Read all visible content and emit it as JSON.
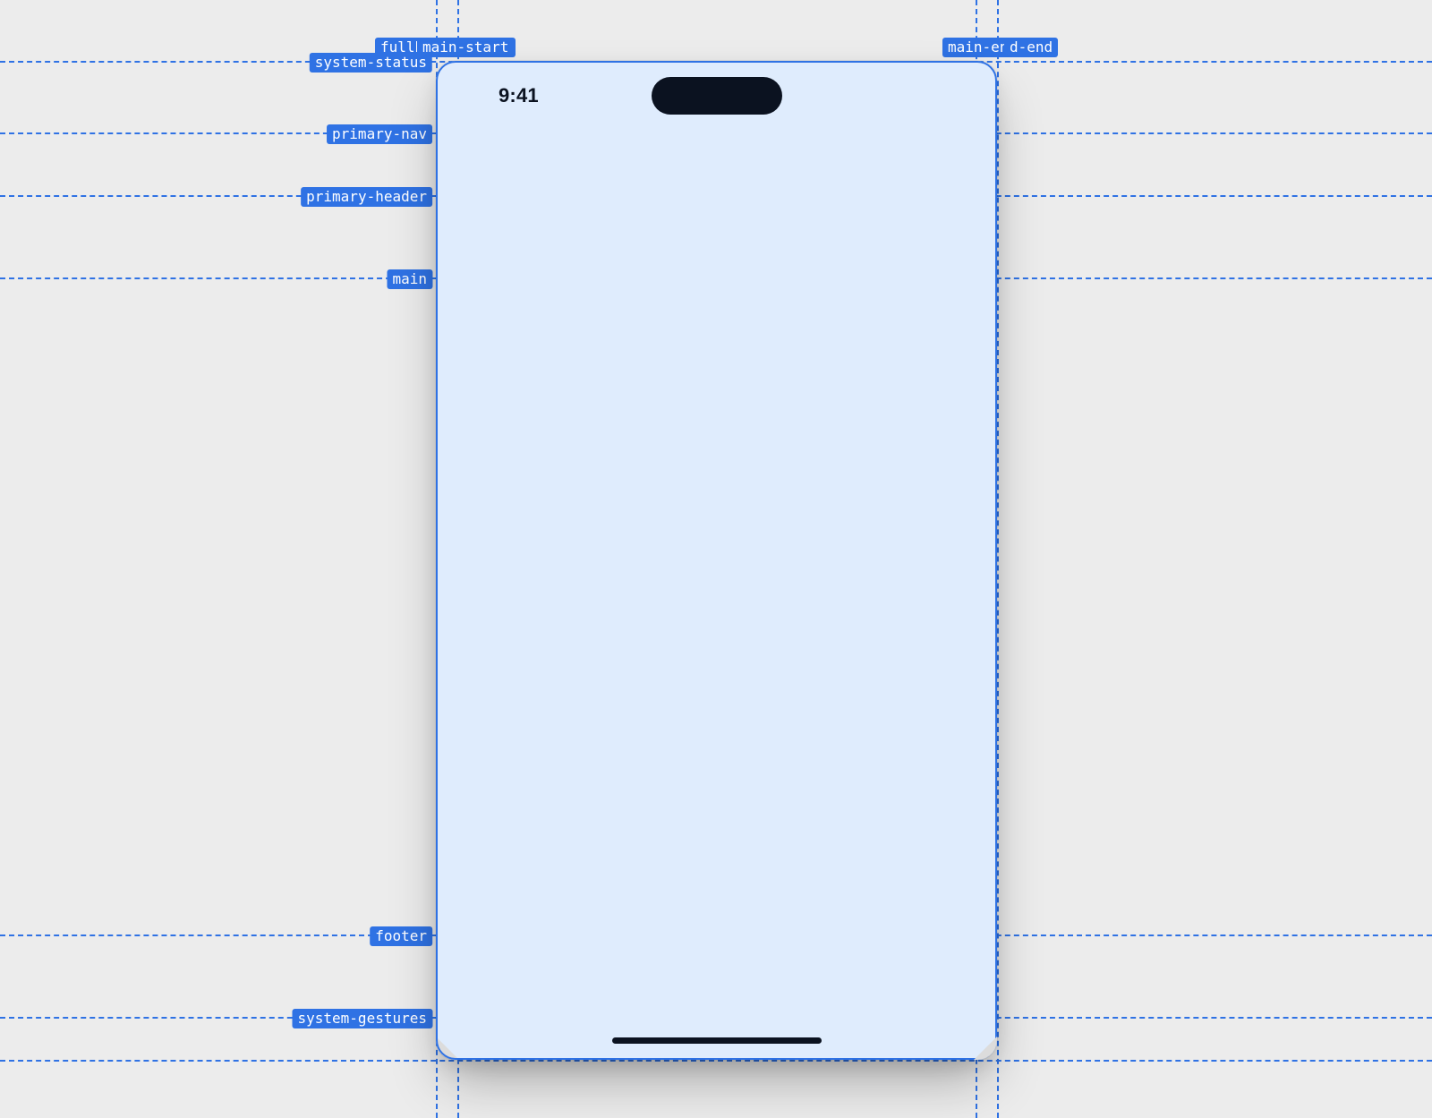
{
  "status": {
    "time": "9:41"
  },
  "guides": {
    "vertical": {
      "fullbleed_start": "fullbleed-start",
      "main_start": "main-start",
      "main_end": "main-end",
      "fullbleed_end": "fullbleed-end"
    },
    "horizontal": {
      "system_status": "system-status",
      "primary_nav": "primary-nav",
      "primary_header": "primary-header",
      "main": "main",
      "footer": "footer",
      "system_gestures": "system-gestures"
    }
  },
  "colors": {
    "guide": "#2f72e4",
    "surface": "#dfecfd",
    "canvas": "#ececec",
    "ink": "#0b1220"
  }
}
